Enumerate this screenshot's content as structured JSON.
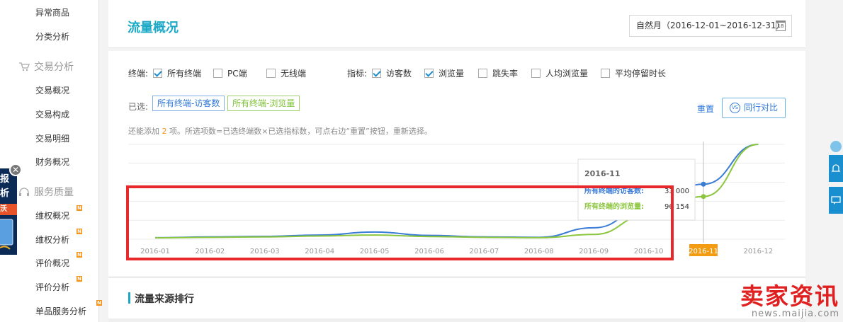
{
  "sidebar": {
    "items_top": [
      {
        "label": "异常商品",
        "new": false
      },
      {
        "label": "分类分析",
        "new": false
      }
    ],
    "sections": [
      {
        "label": "交易分析",
        "icon": "cart-icon"
      },
      {
        "label": "服务质量",
        "icon": "headset-icon"
      }
    ],
    "trade_items": [
      "交易概况",
      "交易构成",
      "交易明细",
      "财务概况"
    ],
    "service_items": [
      "维权概况",
      "维权分析",
      "评价概况",
      "评价分析",
      "单品服务分析"
    ],
    "new_badge": "N"
  },
  "ad": {
    "lines": [
      "报",
      "析",
      "沃"
    ],
    "close_glyph": "✕"
  },
  "header": {
    "title": "流量概况",
    "date_range": "自然月（2016-12-01~2016-12-31）",
    "calendar_glyph": "18"
  },
  "filters": {
    "terminal_label": "终端:",
    "terminal_options": [
      {
        "label": "所有终端",
        "checked": true
      },
      {
        "label": "PC端",
        "checked": false
      },
      {
        "label": "无线端",
        "checked": false
      }
    ],
    "metric_label": "指标:",
    "metric_options": [
      {
        "label": "访客数",
        "checked": true
      },
      {
        "label": "浏览量",
        "checked": true
      },
      {
        "label": "跳失率",
        "checked": false
      },
      {
        "label": "人均浏览量",
        "checked": false
      },
      {
        "label": "平均停留时长",
        "checked": false
      }
    ]
  },
  "selected": {
    "label": "已选:",
    "tags": [
      "所有终端-访客数",
      "所有终端-浏览量"
    ],
    "reset": "重置",
    "compare_button": "同行对比",
    "compare_icon_text": "VS"
  },
  "hint": {
    "prefix": "还能添加 ",
    "count": "2",
    "suffix": " 项。所选项数=已选终端数×已选指标数，可点右边“重置”按钮，重新选择。"
  },
  "chart_data": {
    "type": "line",
    "x": [
      "2016-01",
      "2016-02",
      "2016-03",
      "2016-04",
      "2016-05",
      "2016-06",
      "2016-07",
      "2016-08",
      "2016-09",
      "2016-10",
      "2016-11",
      "2016-12"
    ],
    "highlight_x": "2016-11",
    "series": [
      {
        "name": "所有终端的访客数",
        "color": "#3a7bd5",
        "values": [
          0.08,
          0.12,
          0.15,
          0.22,
          0.38,
          0.2,
          0.12,
          0.1,
          0.6,
          1.75,
          2.9,
          5.0
        ]
      },
      {
        "name": "所有终端的浏览量",
        "color": "#8cc63f",
        "values": [
          0.07,
          0.1,
          0.12,
          0.17,
          0.22,
          0.14,
          0.1,
          0.08,
          0.25,
          1.3,
          2.25,
          5.0
        ]
      }
    ],
    "tooltip": {
      "title": "2016-11",
      "rows": [
        {
          "label": "所有终端的访客数:",
          "value": "33 000",
          "color": "#3a7bd5"
        },
        {
          "label": "所有终端的浏览量:",
          "value": "96 154",
          "color": "#8cc63f"
        }
      ]
    }
  },
  "bottom": {
    "title": "流量来源排行"
  },
  "right_float": {
    "icons": [
      "bell-icon",
      "chat-icon"
    ]
  },
  "watermark": {
    "line1": "卖家资讯",
    "line2": "news.maijia.com"
  },
  "colors": {
    "accent": "#1ba9c7",
    "link": "#2f79d8",
    "highlight": "#f39c12",
    "annotation": "#e8282b"
  }
}
